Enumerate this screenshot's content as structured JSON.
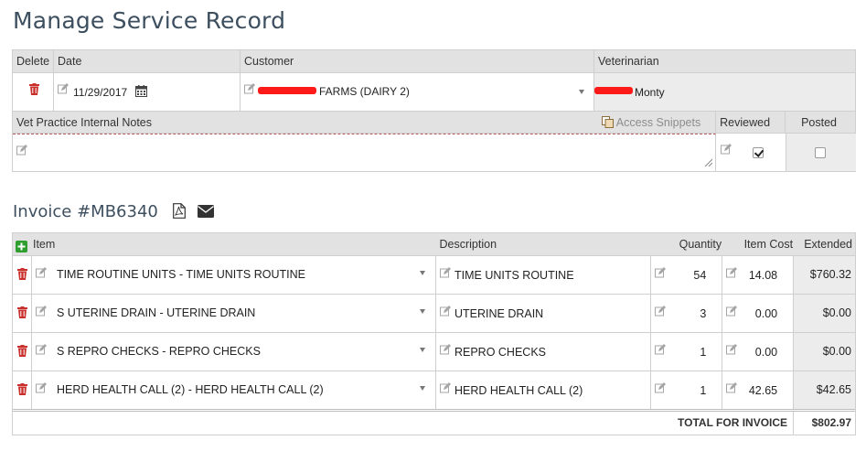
{
  "page": {
    "title": "Manage Service Record"
  },
  "record": {
    "headers": {
      "delete": "Delete",
      "date": "Date",
      "customer": "Customer",
      "veterinarian": "Veterinarian"
    },
    "date": "11/29/2017",
    "customer": "FARMS (DAIRY 2)",
    "veterinarian": "Monty",
    "notes_header": "Vet Practice Internal Notes",
    "access_snippets": "Access Snippets",
    "reviewed_label": "Reviewed",
    "posted_label": "Posted",
    "reviewed": true,
    "posted": false
  },
  "invoice": {
    "title": "Invoice #MB6340",
    "headers": {
      "item": "Item",
      "description": "Description",
      "quantity": "Quantity",
      "item_cost": "Item Cost",
      "extended": "Extended"
    },
    "rows": [
      {
        "item": "TIME ROUTINE UNITS - TIME UNITS ROUTINE",
        "description": "TIME UNITS ROUTINE",
        "quantity": "54",
        "cost": "14.08",
        "extended": "$760.32"
      },
      {
        "item": "S UTERINE DRAIN - UTERINE DRAIN",
        "description": "UTERINE DRAIN",
        "quantity": "3",
        "cost": "0.00",
        "extended": "$0.00"
      },
      {
        "item": "S REPRO CHECKS - REPRO CHECKS",
        "description": "REPRO CHECKS",
        "quantity": "1",
        "cost": "0.00",
        "extended": "$0.00"
      },
      {
        "item": "HERD HEALTH CALL (2) - HERD HEALTH CALL (2)",
        "description": "HERD HEALTH CALL (2)",
        "quantity": "1",
        "cost": "42.65",
        "extended": "$42.65"
      }
    ],
    "total_label": "TOTAL FOR INVOICE",
    "total": "$802.97"
  },
  "colors": {
    "trash": "#c9302c",
    "add": "#2e9e2e",
    "title": "#3d4f5f",
    "header_bg": "#e2e2e2",
    "redaction": "#ff1a1a"
  },
  "icons": [
    "pencil-icon",
    "trash-icon",
    "calendar-icon",
    "pdf-icon",
    "envelope-icon",
    "plus-icon",
    "copy-icon",
    "chevron-down-icon"
  ]
}
